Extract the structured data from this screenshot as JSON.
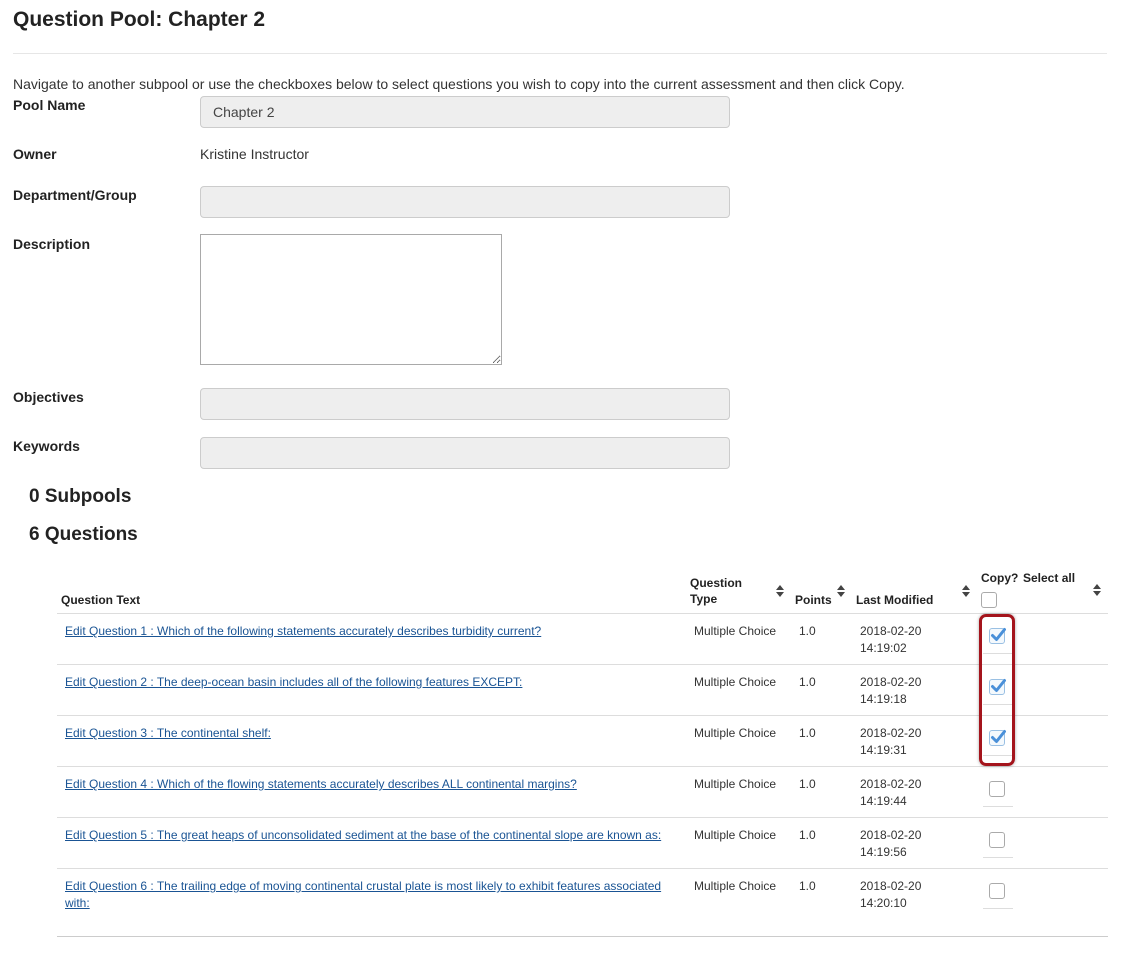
{
  "page": {
    "title": "Question Pool: Chapter 2",
    "instructions": "Navigate to another subpool or use the checkboxes below to select questions you wish to copy into the current assessment and then click Copy."
  },
  "form": {
    "pool_name_label": "Pool Name",
    "pool_name_value": "Chapter 2",
    "owner_label": "Owner",
    "owner_value": "Kristine Instructor",
    "department_label": "Department/Group",
    "department_value": "",
    "description_label": "Description",
    "description_value": "",
    "objectives_label": "Objectives",
    "objectives_value": "",
    "keywords_label": "Keywords",
    "keywords_value": ""
  },
  "sections": {
    "subpools": "0 Subpools",
    "questions": "6 Questions"
  },
  "table": {
    "headers": {
      "question_text": "Question Text",
      "question_type_line1": "Question",
      "question_type_line2": "Type",
      "points": "Points",
      "last_modified": "Last Modified",
      "copy": "Copy?",
      "select_all": "Select all"
    },
    "rows": [
      {
        "text": "Edit Question 1 : Which of the following statements accurately describes turbidity current?",
        "type": "Multiple Choice",
        "points": "1.0",
        "date": "2018-02-20",
        "time": "14:19:02",
        "checked": true
      },
      {
        "text": "Edit Question 2 : The deep-ocean basin includes all of the following features EXCEPT:",
        "type": "Multiple Choice",
        "points": "1.0",
        "date": "2018-02-20",
        "time": "14:19:18",
        "checked": true
      },
      {
        "text": "Edit Question 3 : The continental shelf:",
        "type": "Multiple Choice",
        "points": "1.0",
        "date": "2018-02-20",
        "time": "14:19:31",
        "checked": true
      },
      {
        "text": "Edit Question 4 : Which of the flowing statements accurately describes ALL continental margins?",
        "type": "Multiple Choice",
        "points": "1.0",
        "date": "2018-02-20",
        "time": "14:19:44",
        "checked": false
      },
      {
        "text": "Edit Question 5 : The great heaps of unconsolidated sediment at the base of the continental slope are known as:",
        "type": "Multiple Choice",
        "points": "1.0",
        "date": "2018-02-20",
        "time": "14:19:56",
        "checked": false
      },
      {
        "text": "Edit Question 6 : The trailing edge of moving continental crustal plate is most likely to exhibit features associated with:",
        "type": "Multiple Choice",
        "points": "1.0",
        "date": "2018-02-20",
        "time": "14:20:10",
        "checked": false
      }
    ]
  },
  "colors": {
    "link": "#1a5494",
    "highlight": "#a4141c",
    "checkmark": "#4a90d9"
  }
}
